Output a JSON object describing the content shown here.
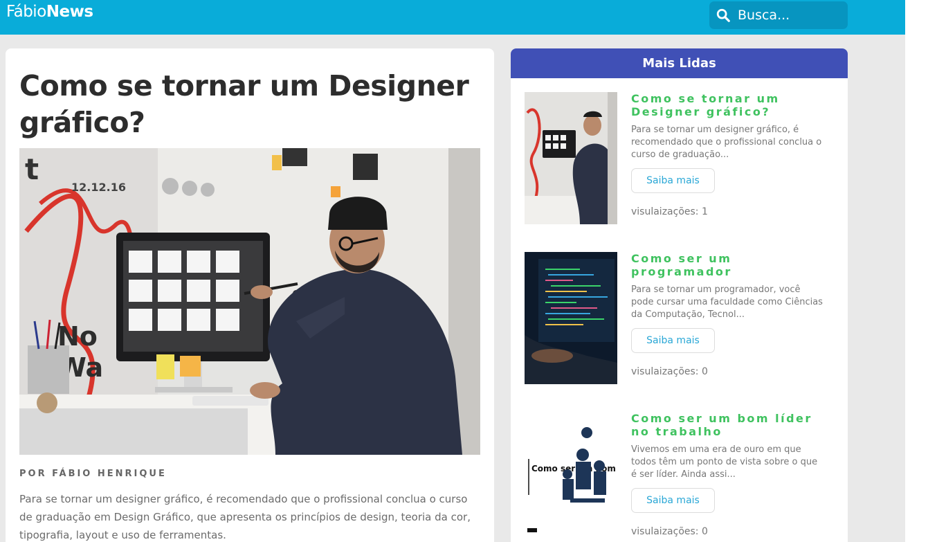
{
  "header": {
    "logo_light": "Fábio",
    "logo_bold": "News",
    "search_placeholder": "Busca..."
  },
  "article": {
    "title": "Como se tornar um Designer gráfico?",
    "author": "POR FÁBIO HENRIQUE",
    "excerpt": "Para se tornar um designer gráfico, é recomendado que o profissional conclua o curso de graduação em Design Gráfico, que apresenta os princípios de design, teoria da cor, tipografia, layout e uso de ferramentas."
  },
  "sidebar": {
    "heading": "Mais Lidas",
    "button_label": "Saiba mais",
    "posts": [
      {
        "title": "Como se tornar um Designer gráfico?",
        "text": "Para se tornar um designer gráfico, é recomendado que o profissional conclua o curso de graduação...",
        "views": "visulaizações: 1"
      },
      {
        "title": "Como ser um programador",
        "text": "Para se tornar um programador, você pode cursar uma faculdade como Ciências da Computação, Tecnol...",
        "views": "visulaizações: 0"
      },
      {
        "title": "Como ser um bom líder no trabalho",
        "text": "Vivemos em uma era de ouro em que todos têm um ponto de vista sobre o que é ser líder. Ainda assi...",
        "views": "visulaizações: 0",
        "thumb_text": "Como ser um bom líder"
      }
    ]
  },
  "colors": {
    "topbar": "#09acd9",
    "sidebar_header": "#4050b6",
    "post_title": "#3fc25f",
    "link": "#29a7d6"
  }
}
